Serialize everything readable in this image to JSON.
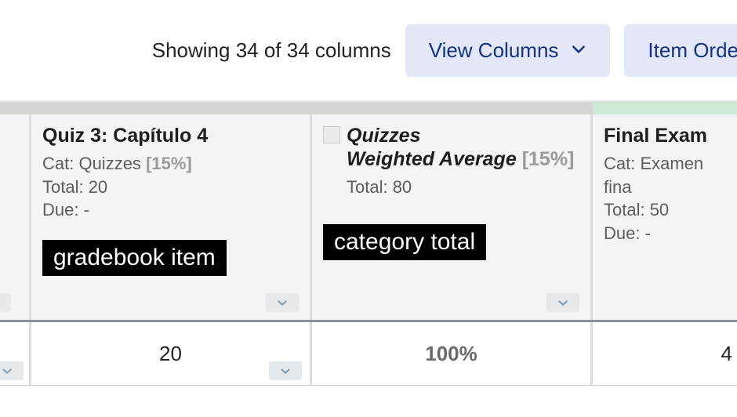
{
  "toolbar": {
    "showing_text": "Showing 34 of 34 columns",
    "view_columns_label": "View Columns",
    "item_order_label": "Item Orde"
  },
  "columns": [
    {
      "title": "Quiz 3: Capítulo 4",
      "cat_label": "Cat: Quizzes",
      "cat_pct": "[15%]",
      "total_label": "Total: 20",
      "due_label": "Due: -",
      "annotation": "gradebook item"
    },
    {
      "title_line1": "Quizzes",
      "title_line2": "Weighted Average",
      "title_pct": "[15%]",
      "total_label": "Total: 80",
      "annotation": "category total"
    },
    {
      "title": "Final Exam",
      "cat_label": "Cat: Examen fina",
      "total_label": "Total: 50",
      "due_label": "Due: -"
    }
  ],
  "row": {
    "c1": "20",
    "c2": "100%",
    "c3": "4"
  }
}
